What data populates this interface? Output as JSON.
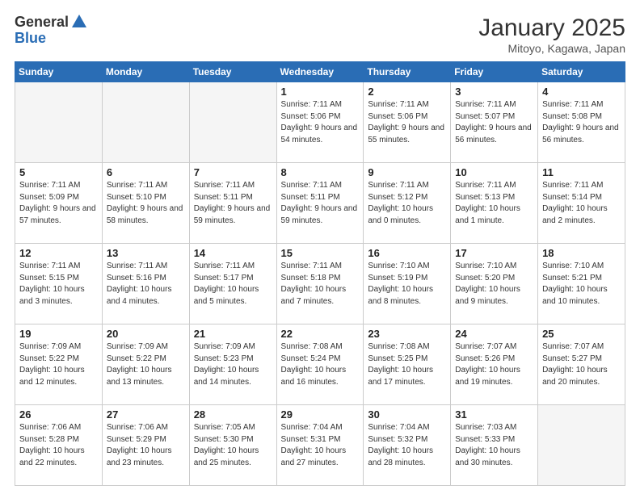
{
  "logo": {
    "general": "General",
    "blue": "Blue"
  },
  "header": {
    "month_year": "January 2025",
    "location": "Mitoyo, Kagawa, Japan"
  },
  "weekdays": [
    "Sunday",
    "Monday",
    "Tuesday",
    "Wednesday",
    "Thursday",
    "Friday",
    "Saturday"
  ],
  "weeks": [
    [
      {
        "day": "",
        "info": ""
      },
      {
        "day": "",
        "info": ""
      },
      {
        "day": "",
        "info": ""
      },
      {
        "day": "1",
        "info": "Sunrise: 7:11 AM\nSunset: 5:06 PM\nDaylight: 9 hours\nand 54 minutes."
      },
      {
        "day": "2",
        "info": "Sunrise: 7:11 AM\nSunset: 5:06 PM\nDaylight: 9 hours\nand 55 minutes."
      },
      {
        "day": "3",
        "info": "Sunrise: 7:11 AM\nSunset: 5:07 PM\nDaylight: 9 hours\nand 56 minutes."
      },
      {
        "day": "4",
        "info": "Sunrise: 7:11 AM\nSunset: 5:08 PM\nDaylight: 9 hours\nand 56 minutes."
      }
    ],
    [
      {
        "day": "5",
        "info": "Sunrise: 7:11 AM\nSunset: 5:09 PM\nDaylight: 9 hours\nand 57 minutes."
      },
      {
        "day": "6",
        "info": "Sunrise: 7:11 AM\nSunset: 5:10 PM\nDaylight: 9 hours\nand 58 minutes."
      },
      {
        "day": "7",
        "info": "Sunrise: 7:11 AM\nSunset: 5:11 PM\nDaylight: 9 hours\nand 59 minutes."
      },
      {
        "day": "8",
        "info": "Sunrise: 7:11 AM\nSunset: 5:11 PM\nDaylight: 9 hours\nand 59 minutes."
      },
      {
        "day": "9",
        "info": "Sunrise: 7:11 AM\nSunset: 5:12 PM\nDaylight: 10 hours\nand 0 minutes."
      },
      {
        "day": "10",
        "info": "Sunrise: 7:11 AM\nSunset: 5:13 PM\nDaylight: 10 hours\nand 1 minute."
      },
      {
        "day": "11",
        "info": "Sunrise: 7:11 AM\nSunset: 5:14 PM\nDaylight: 10 hours\nand 2 minutes."
      }
    ],
    [
      {
        "day": "12",
        "info": "Sunrise: 7:11 AM\nSunset: 5:15 PM\nDaylight: 10 hours\nand 3 minutes."
      },
      {
        "day": "13",
        "info": "Sunrise: 7:11 AM\nSunset: 5:16 PM\nDaylight: 10 hours\nand 4 minutes."
      },
      {
        "day": "14",
        "info": "Sunrise: 7:11 AM\nSunset: 5:17 PM\nDaylight: 10 hours\nand 5 minutes."
      },
      {
        "day": "15",
        "info": "Sunrise: 7:11 AM\nSunset: 5:18 PM\nDaylight: 10 hours\nand 7 minutes."
      },
      {
        "day": "16",
        "info": "Sunrise: 7:10 AM\nSunset: 5:19 PM\nDaylight: 10 hours\nand 8 minutes."
      },
      {
        "day": "17",
        "info": "Sunrise: 7:10 AM\nSunset: 5:20 PM\nDaylight: 10 hours\nand 9 minutes."
      },
      {
        "day": "18",
        "info": "Sunrise: 7:10 AM\nSunset: 5:21 PM\nDaylight: 10 hours\nand 10 minutes."
      }
    ],
    [
      {
        "day": "19",
        "info": "Sunrise: 7:09 AM\nSunset: 5:22 PM\nDaylight: 10 hours\nand 12 minutes."
      },
      {
        "day": "20",
        "info": "Sunrise: 7:09 AM\nSunset: 5:22 PM\nDaylight: 10 hours\nand 13 minutes."
      },
      {
        "day": "21",
        "info": "Sunrise: 7:09 AM\nSunset: 5:23 PM\nDaylight: 10 hours\nand 14 minutes."
      },
      {
        "day": "22",
        "info": "Sunrise: 7:08 AM\nSunset: 5:24 PM\nDaylight: 10 hours\nand 16 minutes."
      },
      {
        "day": "23",
        "info": "Sunrise: 7:08 AM\nSunset: 5:25 PM\nDaylight: 10 hours\nand 17 minutes."
      },
      {
        "day": "24",
        "info": "Sunrise: 7:07 AM\nSunset: 5:26 PM\nDaylight: 10 hours\nand 19 minutes."
      },
      {
        "day": "25",
        "info": "Sunrise: 7:07 AM\nSunset: 5:27 PM\nDaylight: 10 hours\nand 20 minutes."
      }
    ],
    [
      {
        "day": "26",
        "info": "Sunrise: 7:06 AM\nSunset: 5:28 PM\nDaylight: 10 hours\nand 22 minutes."
      },
      {
        "day": "27",
        "info": "Sunrise: 7:06 AM\nSunset: 5:29 PM\nDaylight: 10 hours\nand 23 minutes."
      },
      {
        "day": "28",
        "info": "Sunrise: 7:05 AM\nSunset: 5:30 PM\nDaylight: 10 hours\nand 25 minutes."
      },
      {
        "day": "29",
        "info": "Sunrise: 7:04 AM\nSunset: 5:31 PM\nDaylight: 10 hours\nand 27 minutes."
      },
      {
        "day": "30",
        "info": "Sunrise: 7:04 AM\nSunset: 5:32 PM\nDaylight: 10 hours\nand 28 minutes."
      },
      {
        "day": "31",
        "info": "Sunrise: 7:03 AM\nSunset: 5:33 PM\nDaylight: 10 hours\nand 30 minutes."
      },
      {
        "day": "",
        "info": ""
      }
    ]
  ]
}
